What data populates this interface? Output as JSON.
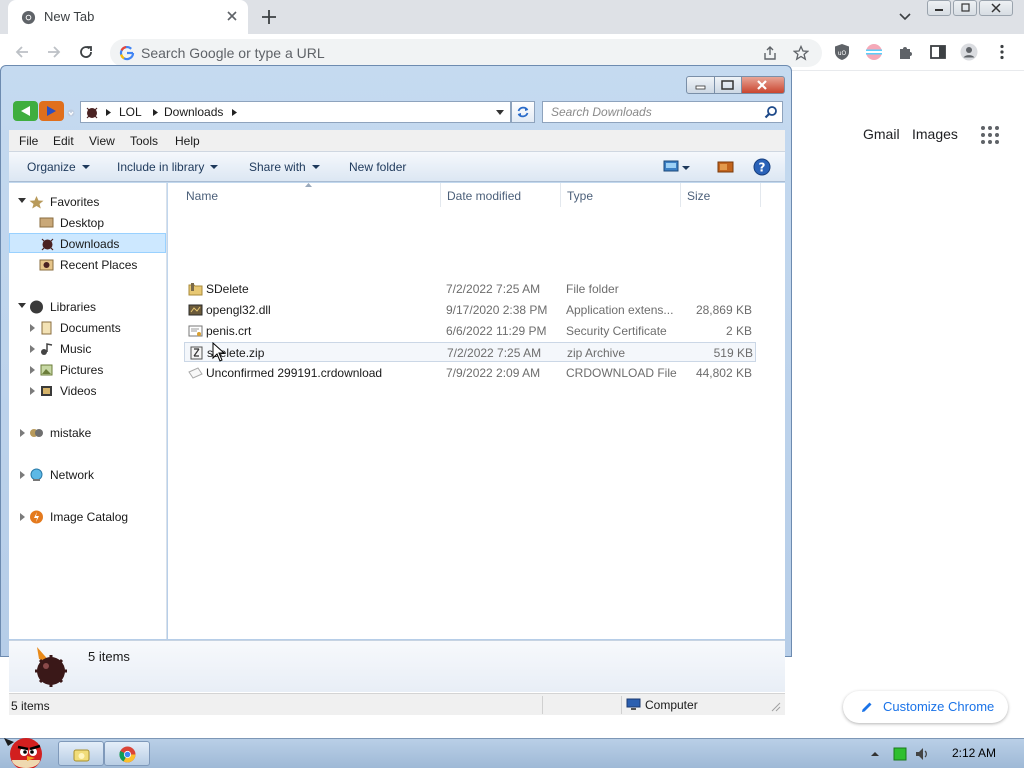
{
  "browser": {
    "tab_title": "New Tab",
    "omnibox_placeholder": "Search Google or type a URL",
    "google_links": [
      "Gmail",
      "Images"
    ],
    "customize_label": "Customize Chrome"
  },
  "explorer": {
    "breadcrumbs": [
      "LOL",
      "Downloads"
    ],
    "search_placeholder": "Search Downloads",
    "menu": [
      "File",
      "Edit",
      "View",
      "Tools",
      "Help"
    ],
    "commands": {
      "organize": "Organize",
      "include": "Include in library",
      "share": "Share with",
      "new_folder": "New folder"
    },
    "nav": {
      "favorites": "Favorites",
      "desktop": "Desktop",
      "downloads": "Downloads",
      "recent": "Recent Places",
      "libraries": "Libraries",
      "documents": "Documents",
      "music": "Music",
      "pictures": "Pictures",
      "videos": "Videos",
      "mistake": "mistake",
      "network": "Network",
      "image_catalog": "Image Catalog"
    },
    "columns": [
      "Name",
      "Date modified",
      "Type",
      "Size"
    ],
    "files": [
      {
        "name": "SDelete",
        "date": "7/2/2022 7:25 AM",
        "type": "File folder",
        "size": ""
      },
      {
        "name": "opengl32.dll",
        "date": "9/17/2020 2:38 PM",
        "type": "Application extens...",
        "size": "28,869 KB"
      },
      {
        "name": "penis.crt",
        "date": "6/6/2022 11:29 PM",
        "type": "Security Certificate",
        "size": "2 KB"
      },
      {
        "name": "sdelete.zip",
        "date": "7/2/2022 7:25 AM",
        "type": "zip Archive",
        "size": "519 KB"
      },
      {
        "name": "Unconfirmed 299191.crdownload",
        "date": "7/9/2022 2:09 AM",
        "type": "CRDOWNLOAD File",
        "size": "44,802 KB"
      }
    ],
    "details_label": "5 items",
    "status_count": "5 items",
    "status_location": "Computer"
  },
  "taskbar": {
    "clock": "2:12 AM"
  },
  "colors": {
    "chrome_tabbar": "#dee1e6",
    "explorer_frame": "#c5daf0",
    "selection": "#cde8ff",
    "link_blue": "#1a73e8"
  }
}
